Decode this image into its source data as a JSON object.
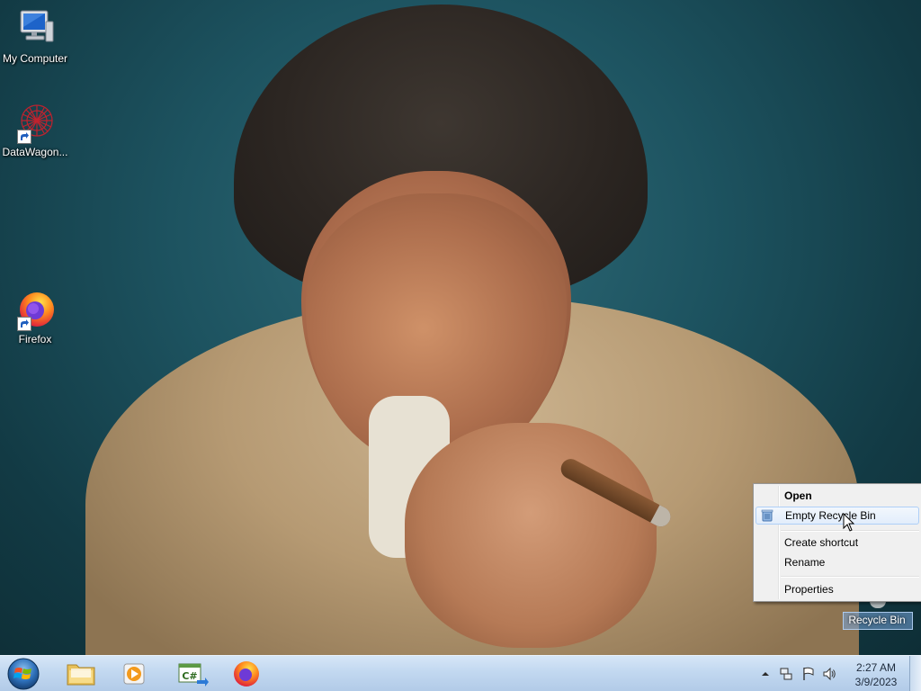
{
  "desktop": {
    "icons": [
      {
        "label": "My Computer",
        "icon": "computer-icon"
      },
      {
        "label": "DataWagon...",
        "icon": "datawagon-icon"
      },
      {
        "label": "Firefox",
        "icon": "firefox-icon"
      }
    ],
    "recycle_bin": {
      "label": "Recycle Bin",
      "icon": "recycle-bin-icon"
    }
  },
  "context_menu": {
    "items": [
      {
        "label": "Open",
        "bold": true
      },
      {
        "label": "Empty Recycle Bin",
        "icon": "recycle-bin-shield-icon",
        "highlighted": true
      },
      {
        "label": "Create shortcut"
      },
      {
        "label": "Rename"
      },
      {
        "label": "Properties"
      }
    ]
  },
  "taskbar": {
    "start": {
      "icon": "windows-start-icon"
    },
    "pinned": [
      {
        "name": "File Explorer",
        "icon": "folder-icon"
      },
      {
        "name": "Media Player",
        "icon": "media-player-icon"
      },
      {
        "name": "C# Editor",
        "icon": "csharp-icon"
      },
      {
        "name": "Firefox",
        "icon": "firefox-icon"
      }
    ],
    "tray": {
      "icons": [
        "show-hidden-icons-arrow",
        "network-icon",
        "action-center-flag-icon",
        "volume-icon"
      ],
      "time": "2:27 AM",
      "date": "3/9/2023"
    }
  },
  "colors": {
    "taskbar": "#c2d8f0",
    "menu_background": "#f0f0f0",
    "menu_highlight_border": "#aecff7",
    "desktop_text": "#ffffff"
  }
}
